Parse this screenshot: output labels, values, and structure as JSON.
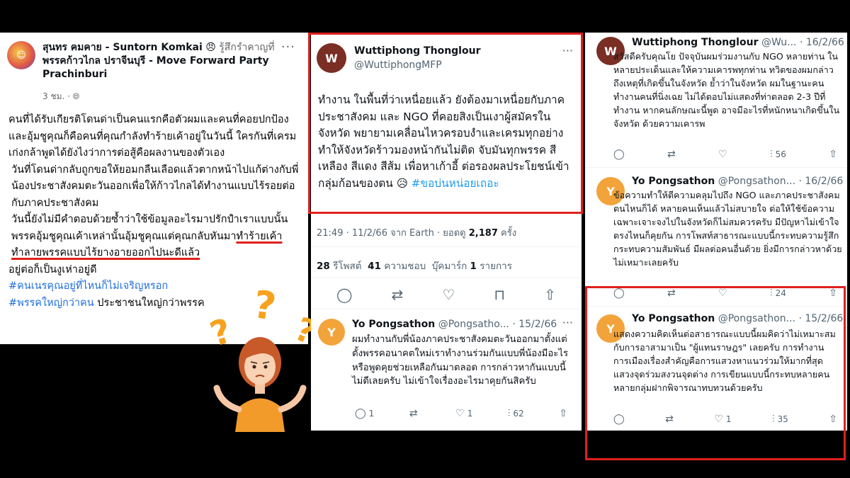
{
  "facebook_post": {
    "author": "สุนทร คมคาย - Suntorn Komkai",
    "feeling_emoji": "😠",
    "feeling_text": "รู้สึกรำคาญที่",
    "page": "พรรคก้าวไกล ปราจีนบุรี - Move Forward Party Prachinburi",
    "time": "3 ชม.",
    "privacy_icon": "globe-icon",
    "more_icon": "···",
    "para1": "คนที่ได้รับเกียรติโดนด่าเป็นคนแรกคือตัวผมและคนที่คอยปกป้องและอุ้มชูคุณก็คือคนที่คุณกำลังทำร้ายเค้าอยู่ในวันนี้ ใครกันที่เครมเก่งกล้าพูดได้ยังไงว่าการต่อสู้คือผลงานของตัวเอง",
    "para2": "วันที่โดนด่ากลับถูกขอให้ยอมกลืนเลือดแล้วตากหน้าไปแก้ต่างกับพี่น้องประชาสังคมตะวันออกเพื่อให้ก้าวไกลได้ทำงานแบบไร้รอยต่อกับภาคประชาสังคม",
    "para3_a": "วันนี้ยังไม่มีคำตอบด้วยซ้ำว่าใช้ข้อมูลอะไรมาปรักปำเราแบบนั้นพรรคอุ้มชูคุณเค้าเหล่านั้นอุ้มชูคุณแต่คุณกลับหันมา",
    "para3_underlined": "ทำร้ายเค้าทำลายพรรคแบบไร้ยางอายออกไปนะดีแล้ว",
    "para3_b": "อยู่ต่อก็เป็นงูเห่าอยู่ดี",
    "hashtag1": "#คนเนรคุณอยู่ที่ไหนก็ไม่เจริญหรอก",
    "hashtag2": "#พรรคใหญ่กว่าคน",
    "tail": " ประชาชนใหญ่กว่าพรรค"
  },
  "main_tweet": {
    "name": "Wuttiphong Thonglour",
    "handle": "@WuttiphongMFP",
    "text": "ทำงาน ในพื้นที่ว่าเหนื่อยแล้ว ยังต้องมาเหนื่อยกับภาคประชาสังคม และ NGO ที่คอยสิงเป็นเงาผู้สมัครในจังหวัด พยายามเคลื่อนไหวครอบงำและเครมทุกอย่าง ทำให้จังหวัดร้าวมองหน้ากันไม่ติด จับมันทุกพรรค สีเหลือง สีแดง สีส้ม เพื่อหาเก้าอี้ ต่อรองผลประโยชน์เข้ากลุ่มก้อนของตน",
    "emoji": "😥",
    "hashtag": "#ขอบ่นหน่อยเถอะ",
    "timestamp": "21:49 · 11/2/66 จาก Earth · ยอดดู",
    "views": "2,187",
    "views_unit": "ครั้ง",
    "retweets": "28",
    "retweets_label": "รีโพสต์",
    "likes": "41",
    "likes_label": "ความชอบ",
    "bookmarks_label": "บุ๊คมาร์ก",
    "bookmarks": "1",
    "bookmarks_unit": "รายการ"
  },
  "mid_reply": {
    "name": "Yo Pongsathon",
    "handle": "@Pongsatho...",
    "date": "· 15/2/66",
    "text": "ผมทำงานกับพี่น้องภาคประชาสังคมตะวันออกมาตั้งแต่ตั้งพรรคอนาคตใหม่เราทำงานร่วมกันแบบพี่น้องมีอะไรหรือพูดคุยช่วยเหลือกันมาตลอด การกล่าวหากันแบบนี้ไม่ดีเลยครับ ไม่เข้าใจเรื่องอะไรมาคุยกันสิครับ",
    "replies": "1",
    "retweets": "",
    "likes": "1",
    "views": "62"
  },
  "right_tweets": [
    {
      "name": "Wuttiphong Thonglour",
      "handle": "@Wu...",
      "date": "· 16/2/66",
      "text": "สวัสดีครับคุณโย ปัจจุบันผมร่วมงานกับ NGO หลายท่าน ในหลายประเด็นและให้ความเคารพทุกท่าน ทวิตของผมกล่าวถึงเหตุที่เกิดขึ้นในจังหวัด ย้ำว่าในจังหวัด ผมในฐานะคนทำงานคนที่นิ่งเฉย ไม่ได้ตอบไม่แสดงที่ท่าตลอด 2-3 ปีที่ทำงาน หากคนลักษณะนี้พูด อาจมีอะไรที่หนักหนาเกิดขึ้นในจังหวัด ด้วยความเคารพ",
      "replies": "",
      "retweets": "",
      "likes": "",
      "views": "56"
    },
    {
      "name": "Yo Pongsathon",
      "handle": "@Pongsathon...",
      "date": "· 16/2/66",
      "text": "ข้อความทำให้ตีความคลุมไปถึง NGO และภาคประชาสังคมตนไหนก็ได้ หลายคนเห็นแล้วไม่สบายใจ ต่อให้ใช้ข้อความเฉพาะเจาะจงไปในจังหวัดก็ไม่สมควรครับ มีปัญหาไม่เข้าใจตรงไหนก็คุยกัน การโพสท์สาธารณะแบบนี้กระทบความรู้สึก กระทบความสัมพันธ์ มีผลต่อคนอื่นด้วย ยิ่งมีการกล่าวหาด้วยไม่เหมาะเลยครับ",
      "replies": "",
      "retweets": "",
      "likes": "",
      "views": "24"
    },
    {
      "name": "Yo Pongsathon",
      "handle": "@Pongsathon...",
      "date": "· 15/2/66",
      "text": "แสดงความคิดเห็นต่อสาธารณะแบบนี้ผมคิดว่าไม่เหมาะสมกับการอาสามาเป็น \"ผู้แทนราษฎร\" เลยครับ การทำงานการเมืองเรื่องสำคัญคือการแสวงหาแนวร่วมให้มากที่สุด แสวงจุดร่วมสงวนจุดต่าง การเขียนแบบนี้กระทบหลายคนหลายกลุ่มฝากพิจารณาทบทวนด้วยครับ",
      "replies": "",
      "retweets": "",
      "likes": "1",
      "views": "35"
    }
  ],
  "colors": {
    "highlight": "#e0201c",
    "link": "#1d9bf0",
    "fb_link": "#216fdb",
    "question": "#f6a21e"
  }
}
